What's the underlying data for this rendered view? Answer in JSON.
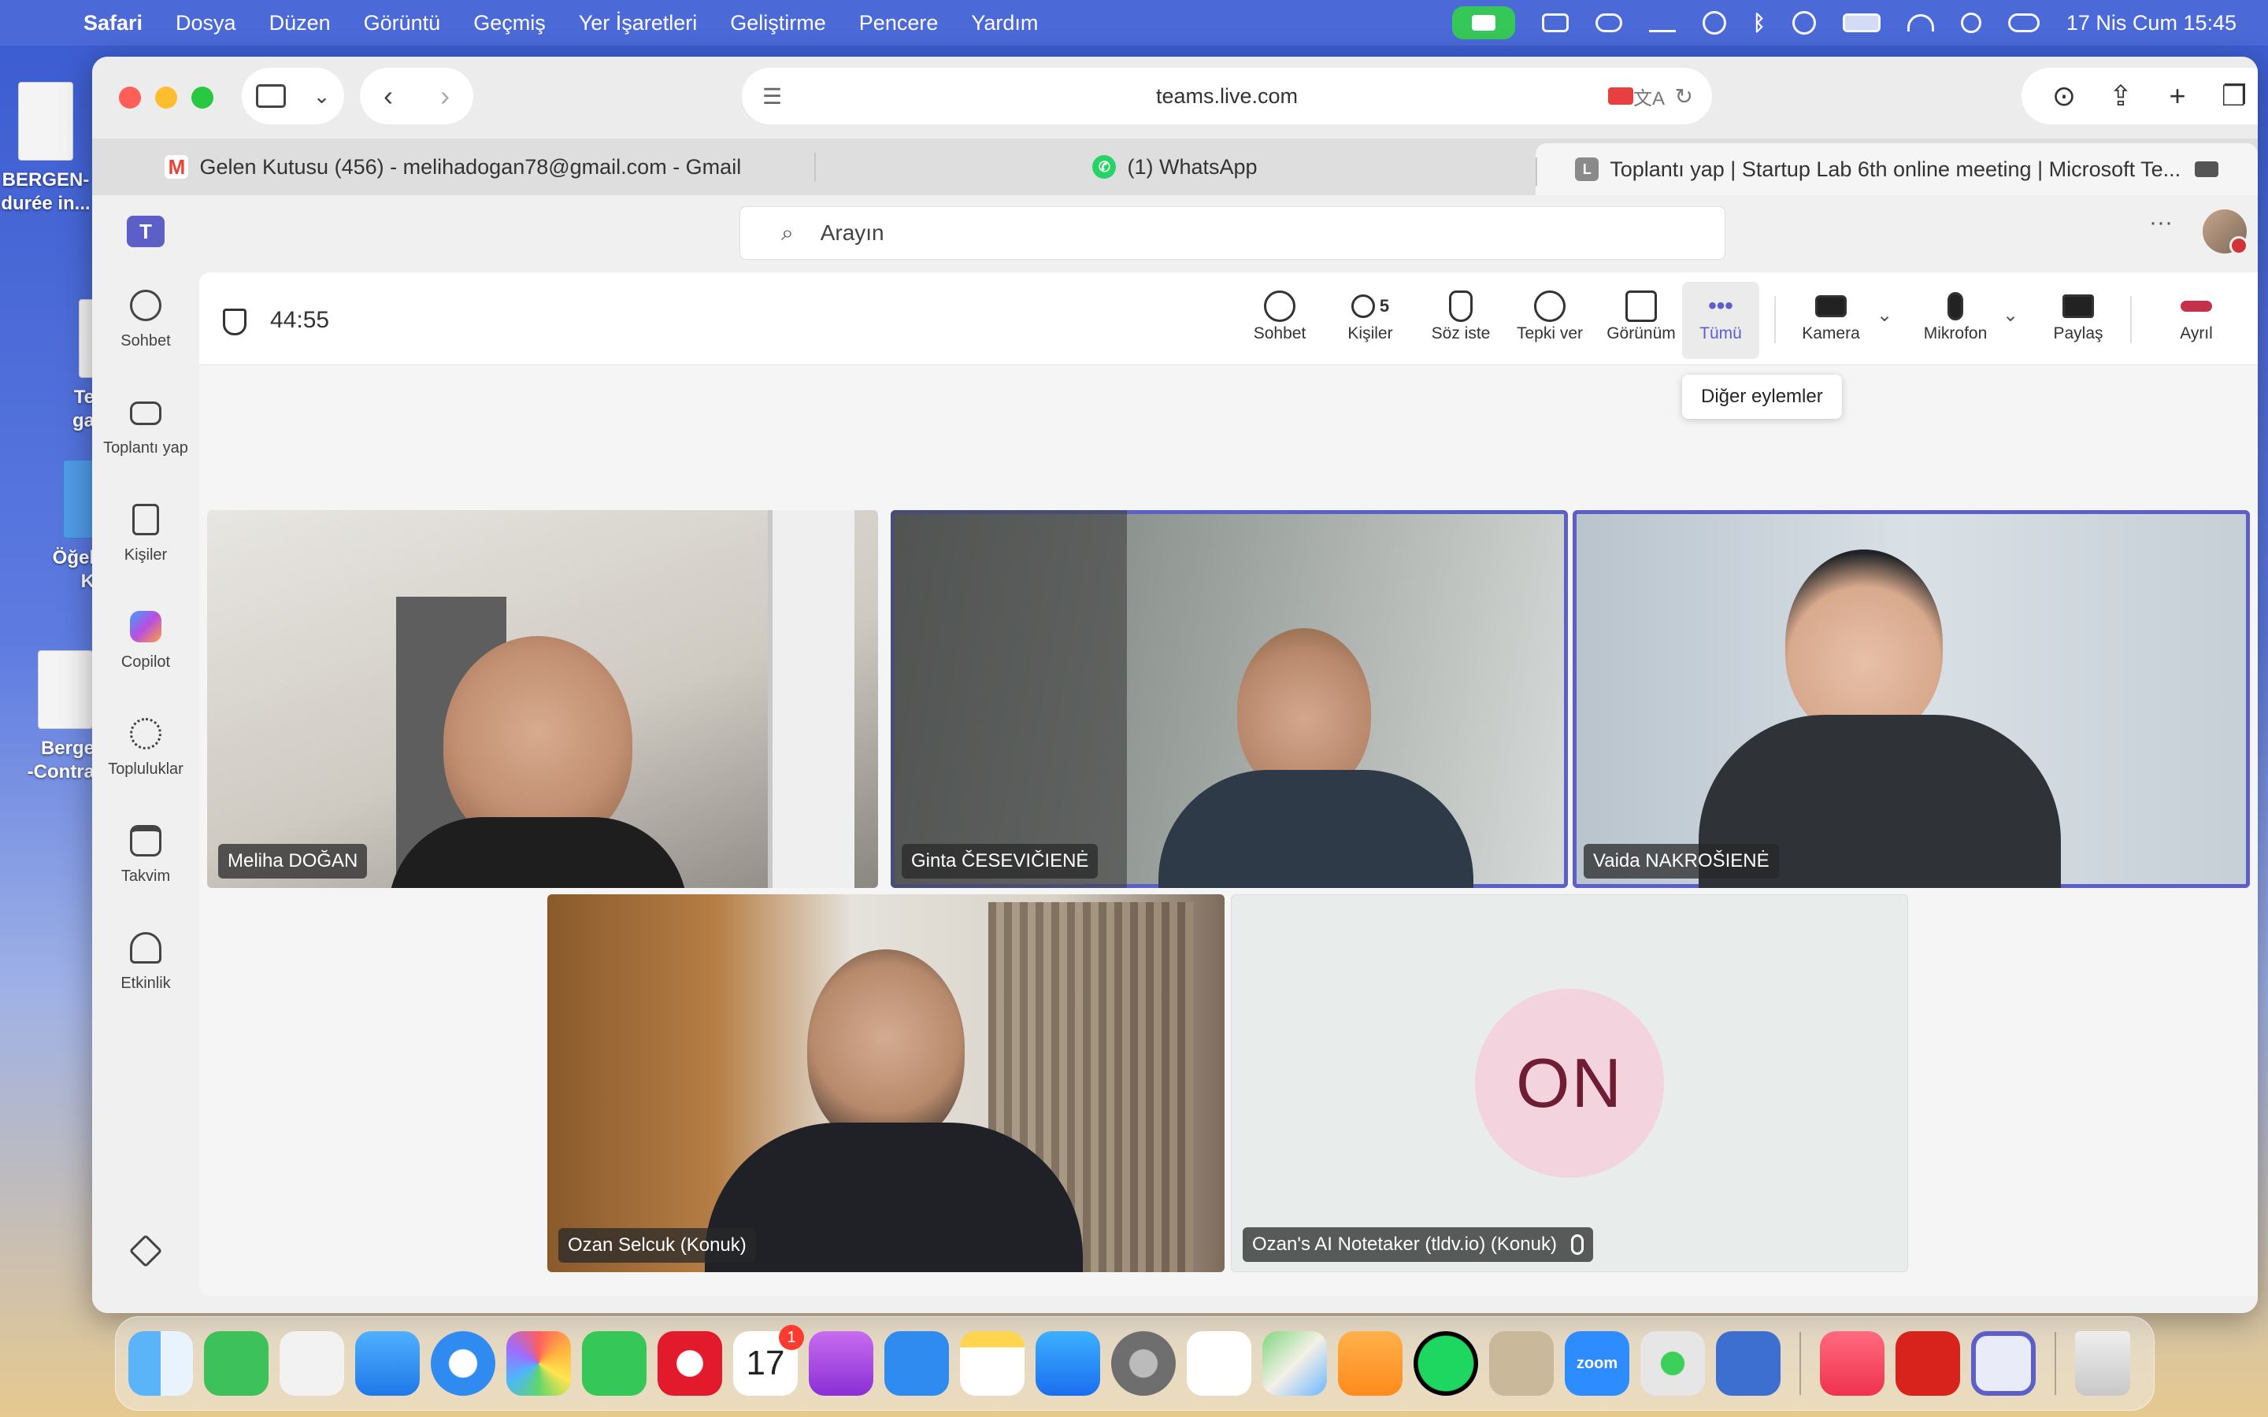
{
  "menubar": {
    "items": [
      "Safari",
      "Dosya",
      "Düzen",
      "Görüntü",
      "Geçmiş",
      "Yer İşaretleri",
      "Geliştirme",
      "Pencere",
      "Yardım"
    ],
    "clock": "17 Nis Cum  15:45"
  },
  "desktop": {
    "icons": [
      {
        "label": "BERGEN-\ndurée in..."
      },
      {
        "label": "Te\nga"
      },
      {
        "label": "Öğel\nK"
      },
      {
        "label": "Berge\n-Contra"
      }
    ]
  },
  "browser": {
    "url": "teams.live.com",
    "tabs": [
      {
        "label": "Gelen Kutusu (456) - melihadogan78@gmail.com - Gmail",
        "icon": "gmail-icon",
        "color": "#ea4335"
      },
      {
        "label": "(1) WhatsApp",
        "icon": "whatsapp-icon",
        "color": "#25d366"
      },
      {
        "label": "Toplantı yap | Startup Lab 6th online meeting | Microsoft Te...",
        "icon": "teams-tab-icon",
        "color": "#8a8a8a",
        "badge": "L"
      }
    ]
  },
  "teams": {
    "search_placeholder": "Arayın",
    "rail": [
      {
        "label": "Sohbet",
        "icon": "chat-icon"
      },
      {
        "label": "Toplantı yap",
        "icon": "video-icon"
      },
      {
        "label": "Kişiler",
        "icon": "contacts-icon"
      },
      {
        "label": "Copilot",
        "icon": "copilot-icon"
      },
      {
        "label": "Topluluklar",
        "icon": "communities-icon"
      },
      {
        "label": "Takvim",
        "icon": "calendar-icon"
      },
      {
        "label": "Etkinlik",
        "icon": "bell-icon"
      }
    ],
    "meeting": {
      "timer": "44:55",
      "controls": [
        {
          "label": "Sohbet",
          "icon": "chat-icon"
        },
        {
          "label": "Kişiler",
          "icon": "people-icon",
          "count": "5"
        },
        {
          "label": "Söz iste",
          "icon": "raise-hand-icon"
        },
        {
          "label": "Tepki ver",
          "icon": "emoji-icon"
        },
        {
          "label": "Görünüm",
          "icon": "layout-icon"
        },
        {
          "label": "Tümü",
          "icon": "more-icon"
        },
        {
          "label": "Kamera",
          "icon": "camera-icon"
        },
        {
          "label": "Mikrofon",
          "icon": "mic-icon"
        },
        {
          "label": "Paylaş",
          "icon": "share-icon"
        },
        {
          "label": "Ayrıl",
          "icon": "hangup-icon"
        }
      ],
      "tooltip": "Diğer eylemler",
      "participants": [
        {
          "name": "Meliha DOĞAN",
          "speaking": false
        },
        {
          "name": "Ginta ČESEVIČIENĖ",
          "speaking": true
        },
        {
          "name": "Vaida NAKROŠIENĖ",
          "speaking": true
        },
        {
          "name": "Ozan Selcuk (Konuk)",
          "speaking": false
        },
        {
          "name": "Ozan's AI Notetaker (tldv.io) (Konuk)",
          "speaking": false,
          "initials": "ON",
          "muted": true
        }
      ]
    }
  },
  "dock": {
    "calendar_day": "17",
    "calendar_badge": "1",
    "zoom_label": "zoom"
  }
}
